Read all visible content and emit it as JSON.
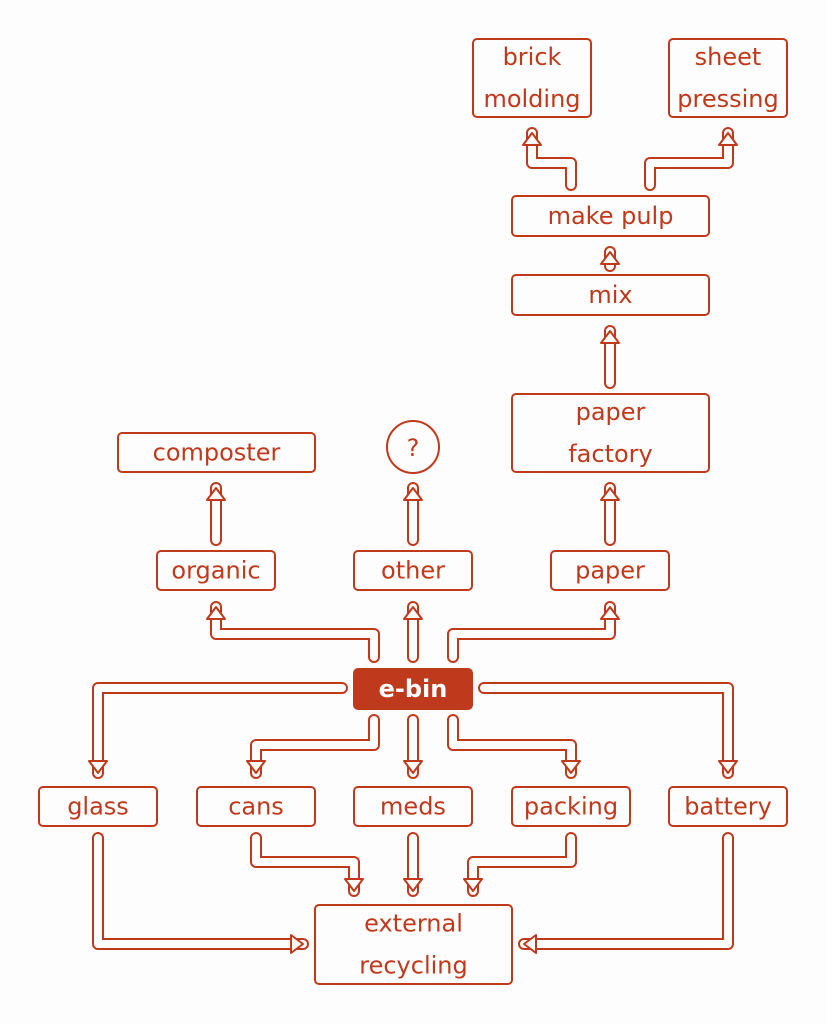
{
  "diagram": {
    "type": "flowchart",
    "accent_color": "#c0391b",
    "background_color": "#fdfdfd",
    "nodes": {
      "brick_molding": [
        "brick",
        "molding"
      ],
      "sheet_pressing": [
        "sheet",
        "pressing"
      ],
      "make_pulp": [
        "make pulp"
      ],
      "mix": [
        "mix"
      ],
      "paper_factory": [
        "paper",
        "factory"
      ],
      "composter": [
        "composter"
      ],
      "unknown": [
        "?"
      ],
      "organic": [
        "organic"
      ],
      "other": [
        "other"
      ],
      "paper": [
        "paper"
      ],
      "ebin": [
        "e-bin"
      ],
      "glass": [
        "glass"
      ],
      "cans": [
        "cans"
      ],
      "meds": [
        "meds"
      ],
      "packing": [
        "packing"
      ],
      "battery": [
        "battery"
      ],
      "external_recycling": [
        "external",
        "recycling"
      ]
    },
    "edges": [
      [
        "ebin",
        "organic"
      ],
      [
        "ebin",
        "other"
      ],
      [
        "ebin",
        "paper"
      ],
      [
        "organic",
        "composter"
      ],
      [
        "other",
        "unknown"
      ],
      [
        "paper",
        "paper_factory"
      ],
      [
        "paper_factory",
        "mix"
      ],
      [
        "mix",
        "make_pulp"
      ],
      [
        "make_pulp",
        "brick_molding"
      ],
      [
        "make_pulp",
        "sheet_pressing"
      ],
      [
        "ebin",
        "glass"
      ],
      [
        "ebin",
        "cans"
      ],
      [
        "ebin",
        "meds"
      ],
      [
        "ebin",
        "packing"
      ],
      [
        "ebin",
        "battery"
      ],
      [
        "glass",
        "external_recycling"
      ],
      [
        "cans",
        "external_recycling"
      ],
      [
        "meds",
        "external_recycling"
      ],
      [
        "packing",
        "external_recycling"
      ],
      [
        "battery",
        "external_recycling"
      ]
    ]
  }
}
